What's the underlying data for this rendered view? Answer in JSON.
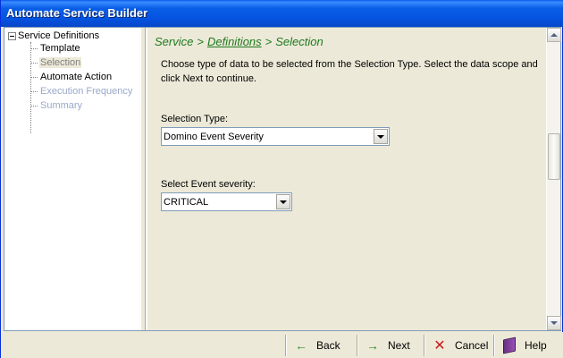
{
  "window": {
    "title": "Automate Service Builder"
  },
  "tree": {
    "root": "Service Definitions",
    "items": [
      {
        "label": "Template",
        "state": "normal"
      },
      {
        "label": "Selection",
        "state": "selected"
      },
      {
        "label": "Automate Action",
        "state": "normal"
      },
      {
        "label": "Execution Frequency",
        "state": "disabled"
      },
      {
        "label": "Summary",
        "state": "disabled"
      }
    ]
  },
  "breadcrumb": {
    "part1": "Service",
    "sep1": ">",
    "part2": "Definitions",
    "sep2": ">",
    "part3": "Selection"
  },
  "instructions": "Choose type of data to be selected from the Selection Type. Select the data scope and click Next to continue.",
  "selection_type": {
    "label": "Selection Type:",
    "value": "Domino Event Severity"
  },
  "event_severity": {
    "label": "Select Event severity:",
    "value": "CRITICAL"
  },
  "buttons": {
    "back": "Back",
    "next": "Next",
    "cancel": "Cancel",
    "help": "Help"
  },
  "colors": {
    "title_bar": "#0553e0",
    "breadcrumb": "#1e7a1e",
    "disabled_text": "#9aa8c8"
  }
}
